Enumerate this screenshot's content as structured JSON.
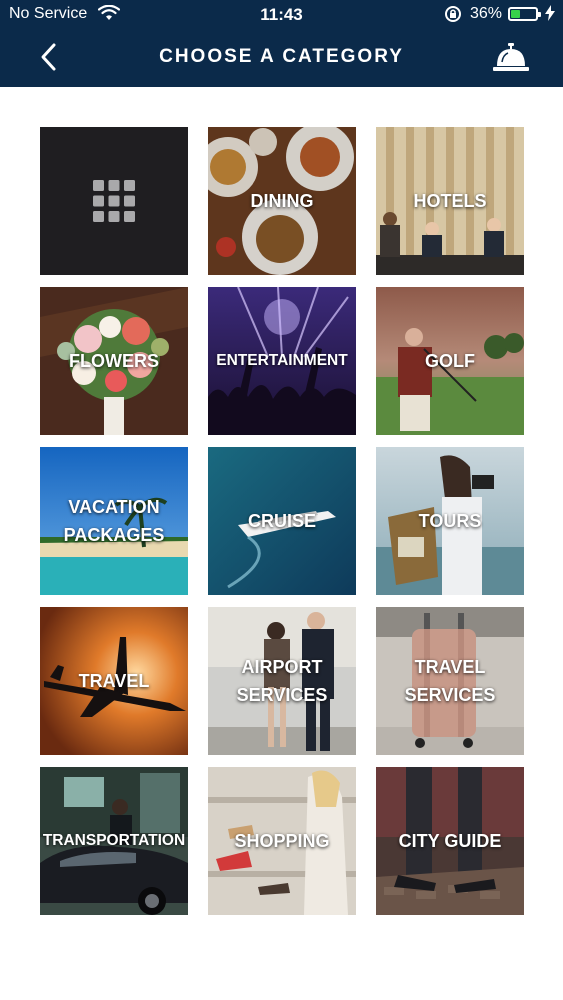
{
  "status_bar": {
    "carrier": "No Service",
    "time": "11:43",
    "battery_percent": "36%",
    "battery_level": 0.36,
    "icons": [
      "wifi-icon",
      "orientation-lock-icon",
      "battery-icon",
      "charging-bolt-icon"
    ]
  },
  "header": {
    "title": "CHOOSE A CATEGORY",
    "back_icon": "chevron-left-icon",
    "right_icon": "concierge-bell-icon"
  },
  "categories": [
    {
      "label": "",
      "icon": "grid-icon"
    },
    {
      "label": "DINING"
    },
    {
      "label": "HOTELS"
    },
    {
      "label": "FLOWERS"
    },
    {
      "label": "ENTERTAINMENT"
    },
    {
      "label": "GOLF"
    },
    {
      "label": "VACATION\nPACKAGES"
    },
    {
      "label": "CRUISE"
    },
    {
      "label": "TOURS"
    },
    {
      "label": "TRAVEL"
    },
    {
      "label": "AIRPORT\nSERVICES"
    },
    {
      "label": "TRAVEL\nSERVICES"
    },
    {
      "label": "TRANSPORTATION"
    },
    {
      "label": "SHOPPING"
    },
    {
      "label": "CITY GUIDE"
    }
  ],
  "colors": {
    "header_bg": "#0b2a4a",
    "battery_fill": "#36d14a",
    "grid_tile_bg": "#1f1e21"
  }
}
